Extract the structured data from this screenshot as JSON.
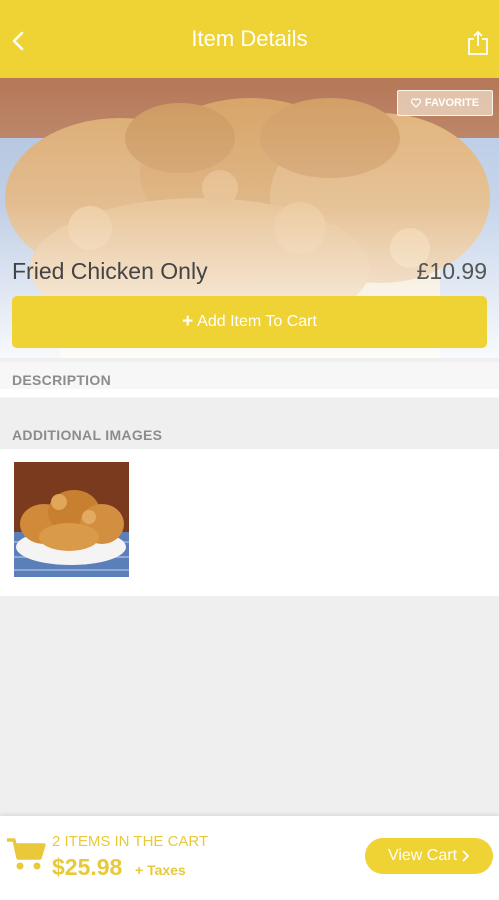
{
  "header": {
    "title": "Item Details",
    "back_icon": "chevron-left-icon",
    "share_icon": "share-icon"
  },
  "item": {
    "favorite_label": "FAVORITE",
    "name": "Fried Chicken Only",
    "price": "£10.99",
    "add_to_cart_label": "Add Item To Cart",
    "add_icon": "plus-icon"
  },
  "sections": {
    "description_title": "DESCRIPTION",
    "additional_images_title": "ADDITIONAL IMAGES"
  },
  "cart": {
    "items_text": "2 ITEMS IN THE CART",
    "total": "$25.98",
    "taxes_text": "+ Taxes",
    "view_cart_label": "View Cart",
    "cart_icon": "cart-icon"
  },
  "colors": {
    "accent": "#efd234",
    "cart_text": "#e9c93a",
    "section_text": "#8c8c8c"
  }
}
